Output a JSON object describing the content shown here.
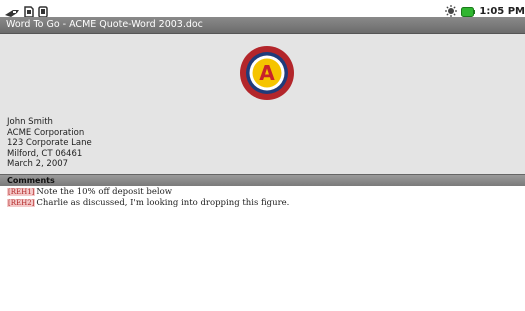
{
  "status_bar": {
    "icons": [
      "usb-icon",
      "sd-card-icon",
      "debug-icon",
      "battery-charging-icon",
      "wifi-icon"
    ],
    "time": "1:05 PM"
  },
  "title_bar": {
    "title": "Word To Go - ACME Quote-Word 2003.doc"
  },
  "document": {
    "logo_letter": "A",
    "logo_colors": {
      "outer": "#b3262b",
      "ring": "#1f3b7a",
      "inner": "#f5c400",
      "letter": "#c8232a"
    },
    "address_lines": [
      "John Smith",
      "ACME Corporation",
      "123 Corporate Lane",
      "Milford, CT 06461",
      "March 2, 2007"
    ]
  },
  "comments": {
    "header": "Comments",
    "items": [
      {
        "tag": "[REH1]",
        "text": "Note the 10% off deposit below"
      },
      {
        "tag": "[REH2]",
        "text": "Charlie as discussed, I'm looking into dropping this figure."
      }
    ]
  }
}
